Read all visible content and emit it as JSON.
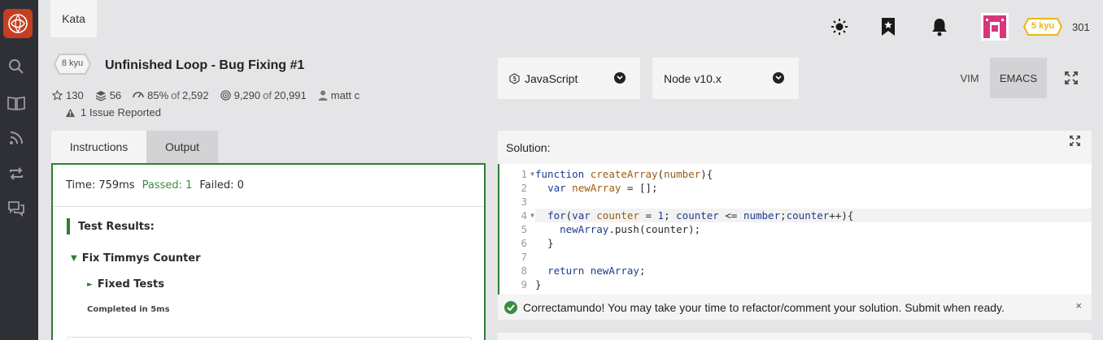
{
  "sidebar": {
    "logo": "codewars-logo",
    "items": [
      {
        "icon": "search-icon"
      },
      {
        "icon": "book-icon"
      },
      {
        "icon": "rss-icon"
      },
      {
        "icon": "exchange-icon"
      },
      {
        "icon": "chat-icon"
      }
    ]
  },
  "header": {
    "tab_label": "Kata",
    "icons": [
      "sun-icon",
      "bookmark-icon",
      "bell-icon"
    ],
    "rank": "5 kyu",
    "honor": "301"
  },
  "kata": {
    "rank": "8 kyu",
    "title": "Unfinished Loop - Bug Fixing #1",
    "stars": "130",
    "collections": "56",
    "satisfaction": "85%",
    "of_word": "of",
    "votes": "2,592",
    "completed": "9,290",
    "attempts": "20,991",
    "author": "matt c",
    "issues": "1 Issue Reported"
  },
  "toolbar": {
    "language": "JavaScript",
    "version": "Node v10.x",
    "modes": [
      "VIM",
      "EMACS"
    ],
    "active_mode": "EMACS"
  },
  "left_panel": {
    "tabs": [
      "Instructions",
      "Output"
    ],
    "active_tab": "Output",
    "time": "Time: 759ms",
    "passed": "Passed: 1",
    "failed": "Failed: 0",
    "results_heading": "Test Results:",
    "group": "Fix Timmys Counter",
    "subgroup": "Fixed Tests",
    "completed_in": "Completed in 5ms"
  },
  "solution": {
    "label": "Solution:",
    "line_numbers": [
      "1",
      "2",
      "3",
      "4",
      "5",
      "6",
      "7",
      "8",
      "9"
    ],
    "message": "Correctamundo! You may take your time to refactor/comment your solution. Submit when ready.",
    "close_symbol": "×"
  },
  "colors": {
    "accent": "#2e7d32",
    "brand": "#c43f22",
    "rank_badge": "#ecb613"
  }
}
